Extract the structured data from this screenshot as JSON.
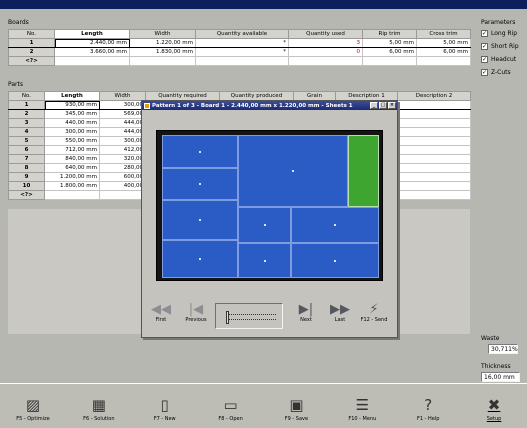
{
  "boards": {
    "section_label": "Boards",
    "columns": [
      "No.",
      "Length",
      "Width",
      "Quantity available",
      "Quantity used",
      "Rip trim",
      "Cross trim"
    ],
    "rows": [
      {
        "no": "1",
        "length": "2.440,00 mm",
        "width": "1.220,00 mm",
        "qty_available": "*",
        "qty_used": "3",
        "rip_trim": "5,00 mm",
        "cross_trim": "5,00 mm"
      },
      {
        "no": "2",
        "length": "3.660,00 mm",
        "width": "1.830,00 mm",
        "qty_available": "*",
        "qty_used": "0",
        "rip_trim": "6,00 mm",
        "cross_trim": "6,00 mm"
      }
    ],
    "new_row_marker": "<?>"
  },
  "parameters": {
    "label": "Parameters",
    "options": [
      {
        "label": "Long Rip",
        "checked": true
      },
      {
        "label": "Short Rip",
        "checked": true
      },
      {
        "label": "Headcut",
        "checked": true
      },
      {
        "label": "Z-Cuts",
        "checked": true
      }
    ]
  },
  "parts": {
    "section_label": "Parts",
    "columns": [
      "No.",
      "Length",
      "Width",
      "Quantity required",
      "Quantity produced",
      "Grain",
      "Description 1",
      "Description 2"
    ],
    "rows": [
      {
        "no": "1",
        "length": "930,00 mm",
        "width": "300,00"
      },
      {
        "no": "2",
        "length": "345,00 mm",
        "width": "569,00"
      },
      {
        "no": "3",
        "length": "440,00 mm",
        "width": "444,00"
      },
      {
        "no": "4",
        "length": "300,00 mm",
        "width": "444,00"
      },
      {
        "no": "5",
        "length": "550,00 mm",
        "width": "300,00"
      },
      {
        "no": "6",
        "length": "712,00 mm",
        "width": "412,00"
      },
      {
        "no": "7",
        "length": "840,00 mm",
        "width": "320,00"
      },
      {
        "no": "8",
        "length": "640,00 mm",
        "width": "280,00"
      },
      {
        "no": "9",
        "length": "1.200,00 mm",
        "width": "600,00"
      },
      {
        "no": "10",
        "length": "1.800,00 mm",
        "width": "400,00"
      }
    ],
    "new_row_marker": "<?>"
  },
  "pattern_window": {
    "title": "Pattern 1 of 3 - Board 1 - 2.440,00 mm x 1.220,00 mm - Sheets 1",
    "window_buttons": [
      "_",
      "□",
      "×"
    ],
    "colors": {
      "panel": "#2b5bc4",
      "waste": "#3fa531",
      "board": "#141414"
    },
    "nav": {
      "first": "First",
      "previous": "Previous",
      "next": "Next",
      "last": "Last",
      "send": "F12 - Send"
    }
  },
  "waste": {
    "label": "Waste",
    "value": "30,711%"
  },
  "thickness": {
    "label": "Thickness",
    "value": "16,00 mm"
  },
  "toolbar": {
    "optimize": "F5 - Optimize",
    "solution": "F6 - Solution",
    "new": "F7 - New",
    "open": "F8 - Open",
    "save": "F9 - Save",
    "menu": "F10 - Menu",
    "help": "F1 - Help",
    "setup": "Setup"
  }
}
